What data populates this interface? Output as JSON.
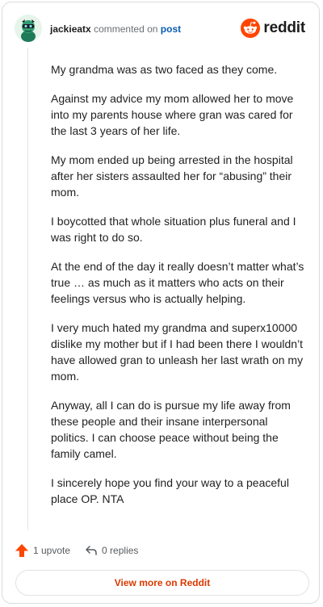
{
  "header": {
    "username": "jackieatx",
    "action_text": "commented on",
    "post_link": "post",
    "brand": "reddit"
  },
  "comment": {
    "paragraphs": [
      "My grandma was as two faced as they come.",
      "Against my advice my mom allowed her to move into my parents house where gran was cared for the last 3 years of her life.",
      "My mom ended up being arrested in the hospital after her sisters assaulted her for “abusing” their mom.",
      "I boycotted that whole situation plus funeral and I was right to do so.",
      "At the end of the day it really doesn’t matter what’s true … as much as it matters who acts on their feelings versus who is actually helping.",
      "I very much hated my grandma and superx10000 dislike my mother but if I had been there I wouldn’t have allowed gran to unleash her last wrath on my mom.",
      "Anyway, all I can do is pursue my life away from these people and their insane interpersonal politics. I can choose peace without being the family camel.",
      "I sincerely hope you find your way to a peaceful place OP. NTA"
    ]
  },
  "actions": {
    "upvote_label": "1 upvote",
    "replies_label": "0 replies"
  },
  "view_more_label": "View more on Reddit",
  "colors": {
    "accent": "#d93a00",
    "upvote": "#ff4500",
    "link": "#0a5cae",
    "border": "#d9dcde"
  }
}
